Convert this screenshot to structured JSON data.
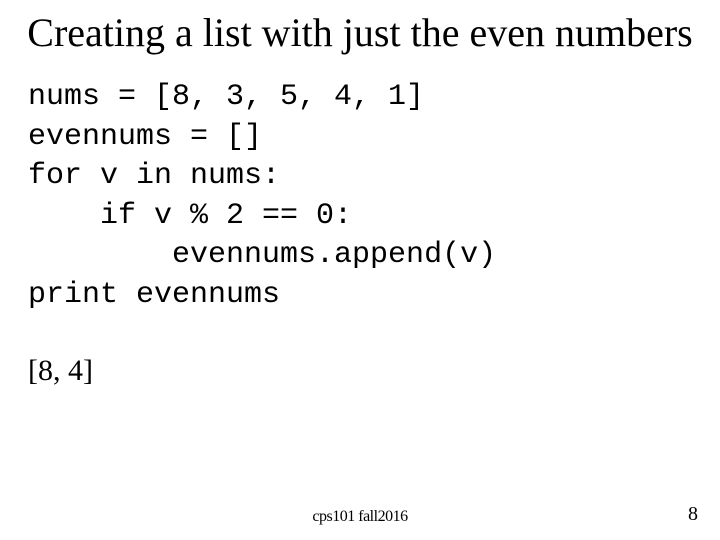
{
  "title": "Creating a list with just the even\nnumbers",
  "code": "nums = [8, 3, 5, 4, 1]\nevennums = []\nfor v in nums:\n    if v % 2 == 0:\n        evennums.append(v)\nprint evennums",
  "output": "[8, 4]",
  "footer_center": "cps101 fall2016",
  "footer_right": "8"
}
